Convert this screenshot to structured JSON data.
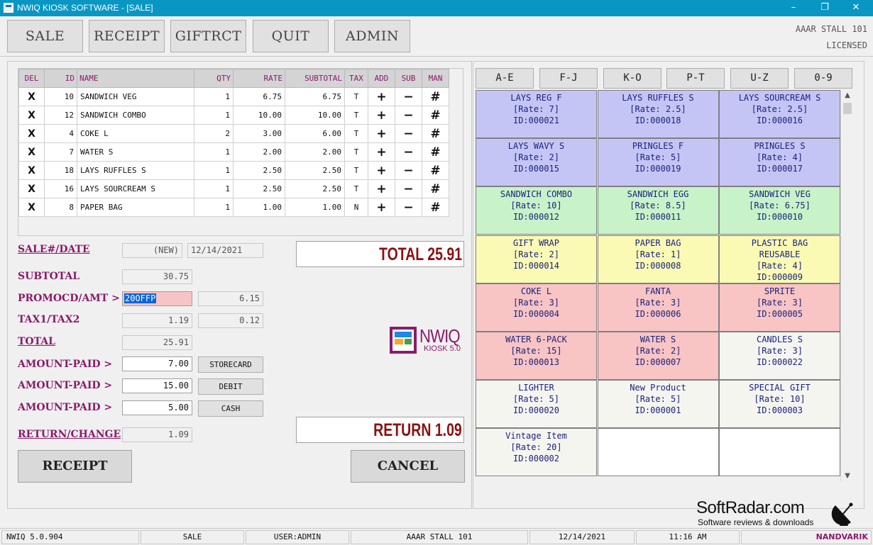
{
  "window": {
    "title": "NWIQ KIOSK SOFTWARE - [SALE]",
    "minimize": "–",
    "maximize": "❐",
    "close": "✕"
  },
  "toolbar": {
    "buttons": [
      "SALE",
      "RECEIPT",
      "GIFTRCT",
      "QUIT",
      "ADMIN"
    ],
    "store_name": "AAAR STALL 101",
    "license": "LICENSED"
  },
  "table": {
    "headers": [
      "DEL",
      "ID",
      "NAME",
      "QTY",
      "RATE",
      "SUBTOTAL",
      "TAX",
      "ADD",
      "SUB",
      "MAN"
    ],
    "del_glyph": "X",
    "add_glyph": "+",
    "sub_glyph": "−",
    "man_glyph": "#",
    "rows": [
      {
        "id": "10",
        "name": "SANDWICH VEG",
        "qty": "1",
        "rate": "6.75",
        "subtotal": "6.75",
        "tax": "T"
      },
      {
        "id": "12",
        "name": "SANDWICH COMBO",
        "qty": "1",
        "rate": "10.00",
        "subtotal": "10.00",
        "tax": "T"
      },
      {
        "id": "4",
        "name": "COKE L",
        "qty": "2",
        "rate": "3.00",
        "subtotal": "6.00",
        "tax": "T"
      },
      {
        "id": "7",
        "name": "WATER S",
        "qty": "1",
        "rate": "2.00",
        "subtotal": "2.00",
        "tax": "T"
      },
      {
        "id": "18",
        "name": "LAYS RUFFLES S",
        "qty": "1",
        "rate": "2.50",
        "subtotal": "2.50",
        "tax": "T"
      },
      {
        "id": "16",
        "name": "LAYS SOURCREAM S",
        "qty": "1",
        "rate": "2.50",
        "subtotal": "2.50",
        "tax": "T"
      },
      {
        "id": "8",
        "name": "PAPER BAG",
        "qty": "1",
        "rate": "1.00",
        "subtotal": "1.00",
        "tax": "N"
      }
    ]
  },
  "form": {
    "sale_label": "SALE#/DATE",
    "sale_no": "(NEW)",
    "date": "12/14/2021",
    "subtotal_label": "SUBTOTAL",
    "subtotal": "30.75",
    "promo_label": "PROMOCD/AMT >",
    "promo_code": "20OFFP",
    "promo_amount": "6.15",
    "tax_label": "TAX1/TAX2",
    "tax1": "1.19",
    "tax2": "0.12",
    "total_label": "TOTAL",
    "total": "25.91",
    "paid_label": "AMOUNT-PAID >",
    "payments": [
      {
        "amount": "7.00",
        "method": "STORECARD"
      },
      {
        "amount": "15.00",
        "method": "DEBIT"
      },
      {
        "amount": "5.00",
        "method": "CASH"
      }
    ],
    "return_label": "RETURN/CHANGE",
    "return_amount": "1.09"
  },
  "displays": {
    "total": "TOTAL 25.91",
    "return": "RETURN 1.09"
  },
  "logo": {
    "word": "NWIQ",
    "version": "KIOSK 5.0"
  },
  "actions": {
    "receipt": "RECEIPT",
    "cancel": "CANCEL"
  },
  "categories": [
    "A-E",
    "F-J",
    "K-O",
    "P-T",
    "U-Z",
    "0-9"
  ],
  "products": [
    {
      "name": "LAYS REG F",
      "rate": "[Rate: 7]",
      "id": "ID:000021",
      "color": "#c5c5f5"
    },
    {
      "name": "LAYS RUFFLES S",
      "rate": "[Rate: 2.5]",
      "id": "ID:000018",
      "color": "#c5c5f5"
    },
    {
      "name": "LAYS SOURCREAM S",
      "rate": "[Rate: 2.5]",
      "id": "ID:000016",
      "color": "#c5c5f5"
    },
    {
      "name": "LAYS WAVY S",
      "rate": "[Rate: 2]",
      "id": "ID:000015",
      "color": "#c5c5f5"
    },
    {
      "name": "PRINGLES F",
      "rate": "[Rate: 5]",
      "id": "ID:000019",
      "color": "#c5c5f5"
    },
    {
      "name": "PRINGLES S",
      "rate": "[Rate: 4]",
      "id": "ID:000017",
      "color": "#c5c5f5"
    },
    {
      "name": "SANDWICH COMBO",
      "rate": "[Rate: 10]",
      "id": "ID:000012",
      "color": "#c8f2c8"
    },
    {
      "name": "SANDWICH EGG",
      "rate": "[Rate: 8.5]",
      "id": "ID:000011",
      "color": "#c8f2c8"
    },
    {
      "name": "SANDWICH VEG",
      "rate": "[Rate: 6.75]",
      "id": "ID:000010",
      "color": "#c8f2c8"
    },
    {
      "name": "GIFT WRAP",
      "rate": "[Rate: 2]",
      "id": "ID:000014",
      "color": "#fafab4"
    },
    {
      "name": "PAPER BAG",
      "rate": "[Rate: 1]",
      "id": "ID:000008",
      "color": "#fafab4"
    },
    {
      "name": "PLASTIC BAG",
      "name2": "REUSABLE",
      "rate": "[Rate: 4]",
      "id": "ID:000009",
      "color": "#fafab4"
    },
    {
      "name": "COKE L",
      "rate": "[Rate: 3]",
      "id": "ID:000004",
      "color": "#f8c4c4"
    },
    {
      "name": "FANTA",
      "rate": "[Rate: 3]",
      "id": "ID:000006",
      "color": "#f8c4c4"
    },
    {
      "name": "SPRITE",
      "rate": "[Rate: 3]",
      "id": "ID:000005",
      "color": "#f8c4c4"
    },
    {
      "name": "WATER 6-PACK",
      "rate": "[Rate: 15]",
      "id": "ID:000013",
      "color": "#f8c4c4"
    },
    {
      "name": "WATER S",
      "rate": "[Rate: 2]",
      "id": "ID:000007",
      "color": "#f8c4c4"
    },
    {
      "name": "CANDLES S",
      "rate": "[Rate: 3]",
      "id": "ID:000022",
      "color": "#f5f5f0"
    },
    {
      "name": "LIGHTER",
      "rate": "[Rate: 5]",
      "id": "ID:000020",
      "color": "#f5f5f0"
    },
    {
      "name": "New Product",
      "rate": "[Rate: 5]",
      "id": "ID:000001",
      "color": "#f5f5f0"
    },
    {
      "name": "SPECIAL GIFT",
      "rate": "[Rate: 10]",
      "id": "ID:000003",
      "color": "#f5f5f0"
    },
    {
      "name": "Vintage Item",
      "rate": "[Rate: 20]",
      "id": "ID:000002",
      "color": "#f5f5f0"
    },
    {
      "name": "",
      "rate": "",
      "id": "",
      "color": "#ffffff"
    },
    {
      "name": "",
      "rate": "",
      "id": "",
      "color": "#ffffff"
    }
  ],
  "scrollbar": {
    "up": "▲",
    "down": "▼"
  },
  "statusbar": {
    "version": "NWIQ 5.0.904",
    "mode": "SALE",
    "user": "USER:ADMIN",
    "store": "AAAR STALL 101",
    "date": "12/14/2021",
    "time": "11:16 AM",
    "brand": "NANDVARIK"
  },
  "watermark": {
    "site": "SoftRadar.com",
    "tagline": "Software reviews & downloads"
  },
  "colors": {
    "label": "#8b1a6b",
    "display_text": "#8b1010",
    "titlebar": "#0a96c2",
    "delete": "#c8101c"
  }
}
